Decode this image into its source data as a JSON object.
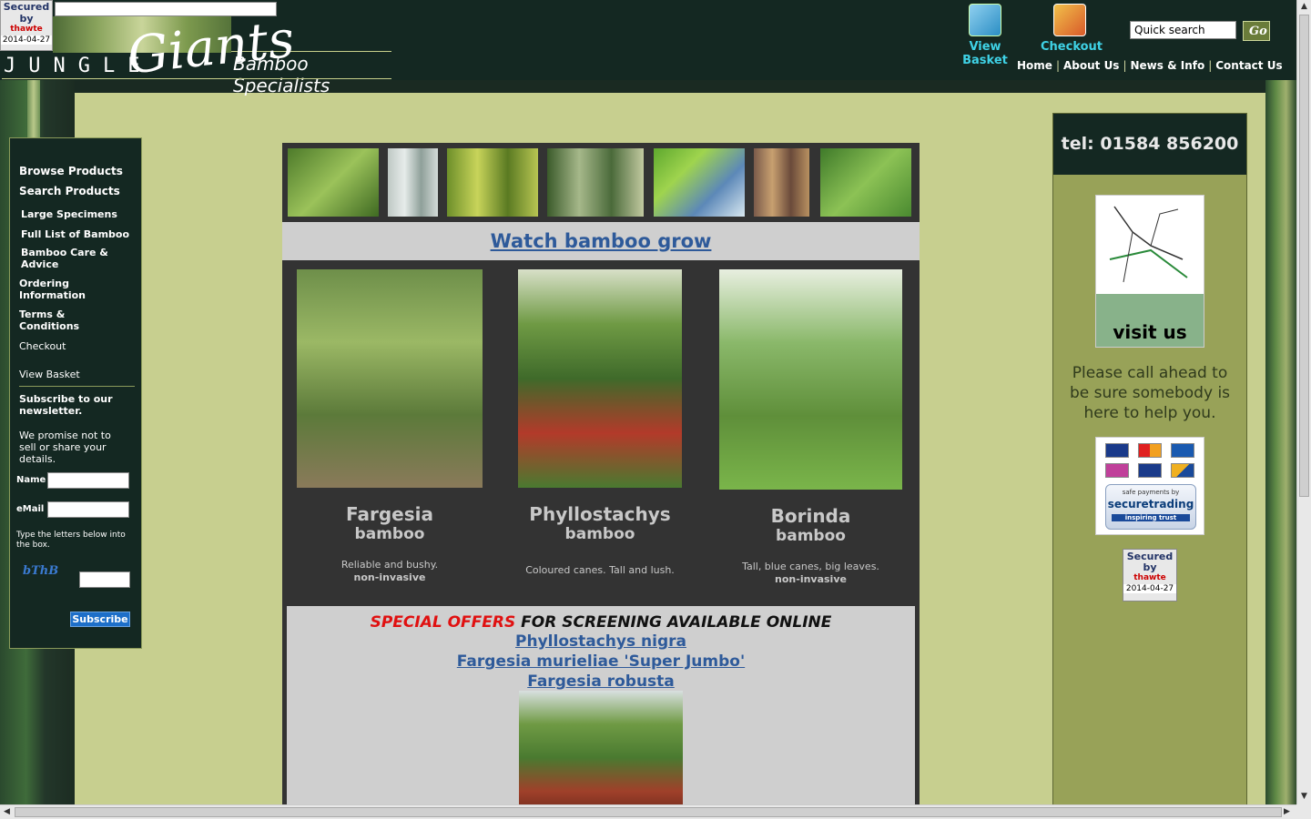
{
  "header": {
    "badge": {
      "line1": "Secured",
      "line2": "by",
      "brand": "thawte",
      "date": "2014-04-27"
    },
    "logo": {
      "jungle": "JUNGLE",
      "giants": "Giants",
      "tagline": "Bamboo Specialists"
    },
    "basket_label": "View Basket",
    "checkout_label": "Checkout",
    "search_placeholder": "Quick search",
    "go_label": "Go",
    "nav": [
      "Home",
      "About Us",
      "News & Info",
      "Contact Us"
    ]
  },
  "sidebar": {
    "items": [
      "Browse Products",
      "Search Products",
      "Large Specimens",
      "Full List of Bamboo",
      "Bamboo Care & Advice",
      "Ordering Information",
      "Terms & Conditions",
      "Checkout",
      "View Basket"
    ],
    "newsletter_title": "Subscribe to our newsletter.",
    "promise": "We promise not to sell or share your details.",
    "name_label": "Name",
    "email_label": "eMail",
    "captcha_hint": "Type the letters below into the box.",
    "captcha_text": "bThB",
    "subscribe_label": "Subscribe"
  },
  "center": {
    "watch_link": "Watch bamboo grow",
    "products": [
      {
        "name": "Fargesia",
        "sub": "bamboo",
        "desc": "Reliable and bushy.",
        "note": "non-invasive"
      },
      {
        "name": "Phyllostachys",
        "sub": "bamboo",
        "desc": "Coloured canes. Tall and lush.",
        "note": ""
      },
      {
        "name": "Borinda",
        "sub": "bamboo",
        "desc": "Tall, blue canes, big leaves.",
        "note": "non-invasive"
      }
    ],
    "offers": {
      "red": "SPECIAL OFFERS",
      "rest": "FOR SCREENING AVAILABLE ONLINE",
      "links": [
        "Phyllostachys nigra",
        "Fargesia murieliae 'Super Jumbo'",
        "Fargesia robusta"
      ]
    }
  },
  "right": {
    "tel": "tel: 01584 856200",
    "visit": "visit us",
    "call_ahead": "Please call ahead to be sure somebody is here to help you.",
    "securetrading": {
      "top": "safe payments by",
      "brand": "securetrading",
      "tag": "inspiring trust"
    }
  },
  "colors": {
    "link": "#2e5a9a",
    "offer_red": "#e01010",
    "accent_cyan": "#3fd2e6"
  }
}
